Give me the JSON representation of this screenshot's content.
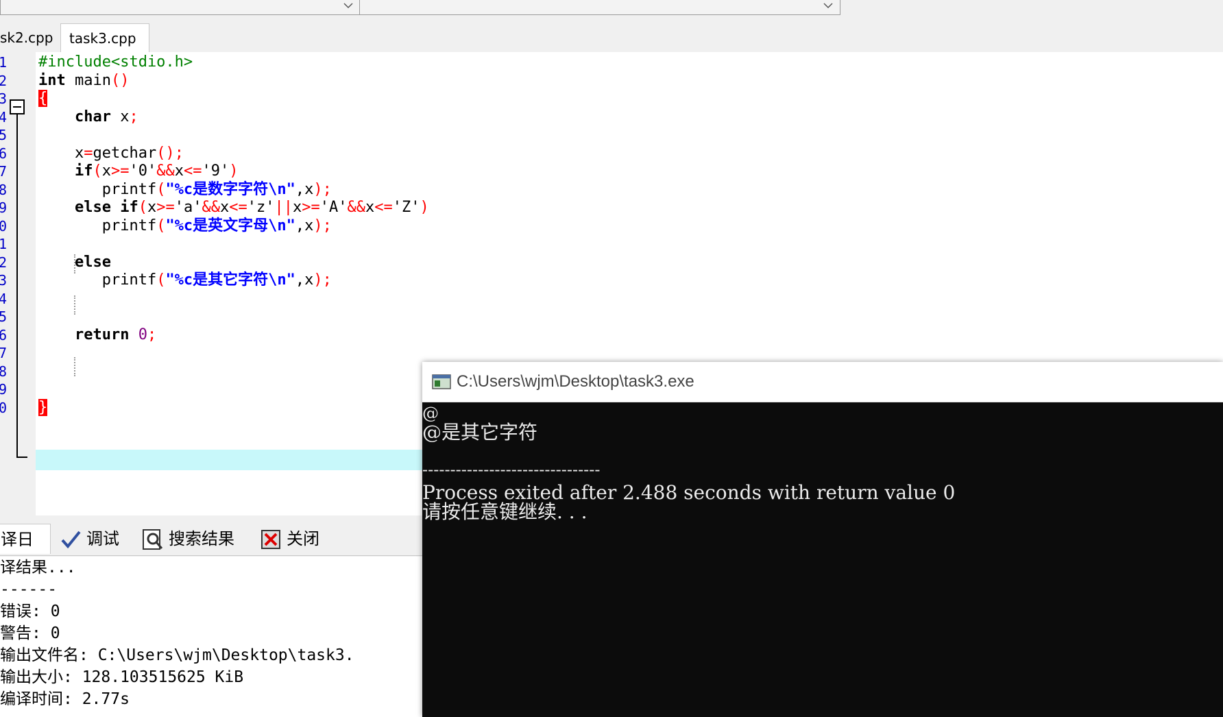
{
  "tabs": [
    "sk2.cpp",
    "task3.cpp"
  ],
  "code": {
    "line_numbers": [
      "1",
      "2",
      "3",
      "4",
      "5",
      "6",
      "7",
      "8",
      "9",
      "0",
      "1",
      "2",
      "3",
      "4",
      "5",
      "6",
      "7",
      "8",
      "9",
      "0"
    ],
    "lines": [
      [
        {
          "t": "#include<stdio.h>",
          "c": "pp"
        }
      ],
      [
        {
          "t": "int",
          "c": "kw"
        },
        {
          "t": " main",
          "c": "plain"
        },
        {
          "t": "()",
          "c": "sym"
        }
      ],
      [
        {
          "t": "{",
          "c": "brace-hl"
        }
      ],
      [
        {
          "t": "    ",
          "c": "plain"
        },
        {
          "t": "char",
          "c": "kw"
        },
        {
          "t": " x",
          "c": "plain"
        },
        {
          "t": ";",
          "c": "sym"
        }
      ],
      [],
      [
        {
          "t": "    x",
          "c": "plain"
        },
        {
          "t": "=",
          "c": "sym"
        },
        {
          "t": "getchar",
          "c": "plain"
        },
        {
          "t": "();",
          "c": "sym"
        }
      ],
      [
        {
          "t": "    ",
          "c": "plain"
        },
        {
          "t": "if",
          "c": "kw"
        },
        {
          "t": "(",
          "c": "sym"
        },
        {
          "t": "x",
          "c": "plain"
        },
        {
          "t": ">=",
          "c": "sym"
        },
        {
          "t": "'0'",
          "c": "plain"
        },
        {
          "t": "&&",
          "c": "sym"
        },
        {
          "t": "x",
          "c": "plain"
        },
        {
          "t": "<=",
          "c": "sym"
        },
        {
          "t": "'9'",
          "c": "plain"
        },
        {
          "t": ")",
          "c": "sym"
        }
      ],
      [
        {
          "t": "       printf",
          "c": "plain"
        },
        {
          "t": "(",
          "c": "sym"
        },
        {
          "t": "\"%c是数字字符\\n\"",
          "c": "str"
        },
        {
          "t": ",x",
          "c": "plain"
        },
        {
          "t": ");",
          "c": "sym"
        }
      ],
      [
        {
          "t": "    ",
          "c": "plain"
        },
        {
          "t": "else if",
          "c": "kw"
        },
        {
          "t": "(",
          "c": "sym"
        },
        {
          "t": "x",
          "c": "plain"
        },
        {
          "t": ">=",
          "c": "sym"
        },
        {
          "t": "'a'",
          "c": "plain"
        },
        {
          "t": "&&",
          "c": "sym"
        },
        {
          "t": "x",
          "c": "plain"
        },
        {
          "t": "<=",
          "c": "sym"
        },
        {
          "t": "'z'",
          "c": "plain"
        },
        {
          "t": "||",
          "c": "sym"
        },
        {
          "t": "x",
          "c": "plain"
        },
        {
          "t": ">=",
          "c": "sym"
        },
        {
          "t": "'A'",
          "c": "plain"
        },
        {
          "t": "&&",
          "c": "sym"
        },
        {
          "t": "x",
          "c": "plain"
        },
        {
          "t": "<=",
          "c": "sym"
        },
        {
          "t": "'Z'",
          "c": "plain"
        },
        {
          "t": ")",
          "c": "sym"
        }
      ],
      [
        {
          "t": "       printf",
          "c": "plain"
        },
        {
          "t": "(",
          "c": "sym"
        },
        {
          "t": "\"%c是英文字母\\n\"",
          "c": "str"
        },
        {
          "t": ",x",
          "c": "plain"
        },
        {
          "t": ");",
          "c": "sym"
        }
      ],
      [],
      [
        {
          "t": "    ",
          "c": "plain"
        },
        {
          "t": "else",
          "c": "kw"
        }
      ],
      [
        {
          "t": "       printf",
          "c": "plain"
        },
        {
          "t": "(",
          "c": "sym"
        },
        {
          "t": "\"%c是其它字符\\n\"",
          "c": "str"
        },
        {
          "t": ",x",
          "c": "plain"
        },
        {
          "t": ");",
          "c": "sym"
        }
      ],
      [],
      [],
      [
        {
          "t": "    ",
          "c": "plain"
        },
        {
          "t": "return",
          "c": "kw"
        },
        {
          "t": " ",
          "c": "plain"
        },
        {
          "t": "0",
          "c": "num"
        },
        {
          "t": ";",
          "c": "sym"
        }
      ],
      [],
      [],
      [],
      [
        {
          "t": "}",
          "c": "brace-hl"
        }
      ]
    ]
  },
  "bottom_tabs": [
    {
      "label": "译日志",
      "icon": "compile-log-icon"
    },
    {
      "label": "调试",
      "icon": "debug-check-icon"
    },
    {
      "label": "搜索结果",
      "icon": "search-results-icon"
    },
    {
      "label": "关闭",
      "icon": "close-icon"
    }
  ],
  "log_lines": [
    "译结果...",
    "------",
    "错误: 0",
    "警告: 0",
    "输出文件名: C:\\Users\\wjm\\Desktop\\task3.",
    "输出大小: 128.103515625 KiB",
    "编译时间: 2.77s"
  ],
  "console": {
    "title": "C:\\Users\\wjm\\Desktop\\task3.exe",
    "lines": [
      "@",
      "@是其它字符",
      "",
      "--------------------------------",
      "Process exited after 2.488 seconds with return value 0",
      "请按任意键继续. . ."
    ]
  },
  "colors": {
    "current_line": "#c8f8fa",
    "brace_highlight": "#ff0000",
    "console_bg": "#0c0c0c"
  }
}
